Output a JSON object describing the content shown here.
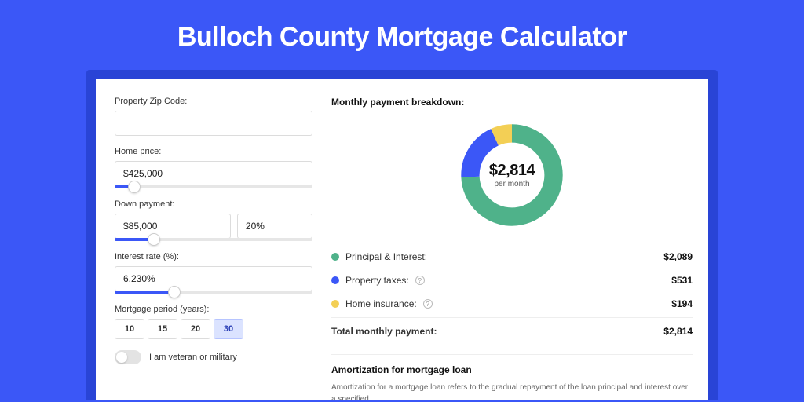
{
  "title": "Bulloch County Mortgage Calculator",
  "form": {
    "zip_label": "Property Zip Code:",
    "zip_value": "",
    "home_price_label": "Home price:",
    "home_price_value": "$425,000",
    "down_payment_label": "Down payment:",
    "down_payment_value": "$85,000",
    "down_payment_pct": "20%",
    "interest_label": "Interest rate (%):",
    "interest_value": "6.230%",
    "period_label": "Mortgage period (years):",
    "periods": [
      "10",
      "15",
      "20",
      "30"
    ],
    "period_selected": "30",
    "veteran_label": "I am veteran or military"
  },
  "breakdown": {
    "title": "Monthly payment breakdown:",
    "center_value": "$2,814",
    "center_sub": "per month",
    "items": [
      {
        "label": "Principal & Interest:",
        "value": "$2,089",
        "color": "#4fb28a",
        "info": false
      },
      {
        "label": "Property taxes:",
        "value": "$531",
        "color": "#3b57f7",
        "info": true
      },
      {
        "label": "Home insurance:",
        "value": "$194",
        "color": "#f3cf55",
        "info": true
      }
    ],
    "total_label": "Total monthly payment:",
    "total_value": "$2,814"
  },
  "amort": {
    "title": "Amortization for mortgage loan",
    "text": "Amortization for a mortgage loan refers to the gradual repayment of the loan principal and interest over a specified"
  },
  "chart_data": {
    "type": "pie",
    "title": "Monthly payment breakdown",
    "series": [
      {
        "name": "Principal & Interest",
        "value": 2089,
        "color": "#4fb28a"
      },
      {
        "name": "Property taxes",
        "value": 531,
        "color": "#3b57f7"
      },
      {
        "name": "Home insurance",
        "value": 194,
        "color": "#f3cf55"
      }
    ],
    "total": 2814,
    "center_label": "$2,814 per month"
  }
}
